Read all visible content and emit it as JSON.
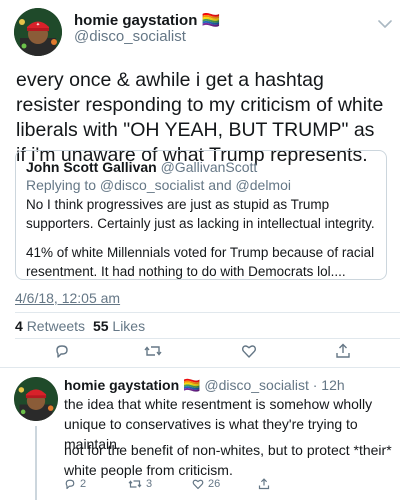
{
  "tweet": {
    "display_name": "homie gaystation",
    "name_emoji": "🏳️‍🌈",
    "handle": "@disco_socialist",
    "text": "every once & awhile i get a hashtag resister responding to my criticism of white liberals with \"OH YEAH, BUT TRUMP\" as if i'm unaware of what Trump represents.",
    "more_icon": "chevron-down-icon"
  },
  "quote": {
    "display_name": "John Scott Gallivan",
    "handle": "@GallivanScott",
    "replying_to": "Replying to @disco_socialist and @delmoi",
    "paragraph_1": "No I think progressives are just as stupid as Trump supporters. Certainly just as lacking in intellectual integrity.",
    "paragraph_2": "41% of white Millennials voted for Trump because of racial resentment. It had nothing to do with Democrats lol...."
  },
  "meta": {
    "date": "4/6/18, 12:05 am"
  },
  "stats": {
    "retweets_count": "4",
    "retweets_label": "Retweets",
    "likes_count": "55",
    "likes_label": "Likes"
  },
  "actions": {
    "icons": [
      "reply-icon",
      "retweet-icon",
      "like-icon",
      "share-icon"
    ]
  },
  "reply": {
    "display_name": "homie gaystation",
    "name_emoji": "🏳️‍🌈",
    "handle": "@disco_socialist",
    "separator": "·",
    "time": "12h",
    "paragraph_1": "the idea that white resentment is somehow wholly unique to conservatives is what they're trying to maintain.",
    "paragraph_2": "not for the benefit of non-whites, but to protect *their* white people from criticism.",
    "reply_count": "2",
    "retweet_count": "3",
    "like_count": "26"
  },
  "colors": {
    "text": "#14171a",
    "secondary": "#657786",
    "border": "#ccd6dd"
  }
}
